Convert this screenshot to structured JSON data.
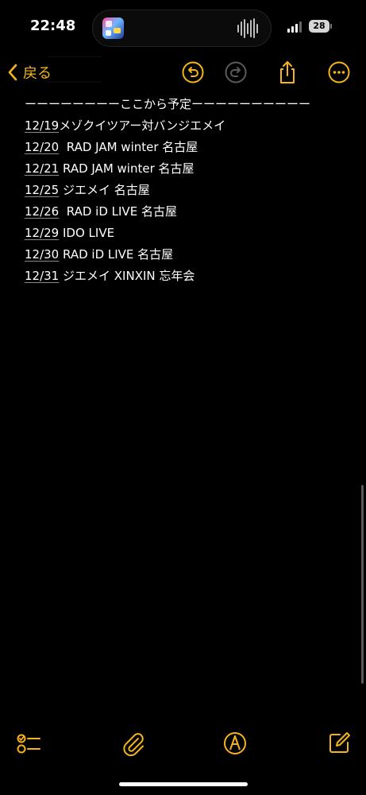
{
  "status_bar": {
    "time": "22:48",
    "battery_level": "28",
    "signal_icon": "cellular-signal-icon",
    "island_app_icon": "app-icon",
    "island_activity_icon": "audio-waveform-icon"
  },
  "nav": {
    "back_label": "戻る",
    "back_icon": "chevron-left-icon",
    "undo_icon": "undo-icon",
    "redo_icon": "redo-icon",
    "share_icon": "share-icon",
    "more_icon": "ellipsis-circle-icon",
    "accent_color": "#F5B41B"
  },
  "note": {
    "divider": "ーーーーーーーーここから予定ーーーーーーーーーー",
    "entries": [
      {
        "date": "12/19",
        "text": " メゾクイツアー対バンジエメイ"
      },
      {
        "date": "12/20",
        "text": "  RAD JAM winter 名古屋"
      },
      {
        "date": "12/21",
        "text": " RAD JAM winter 名古屋"
      },
      {
        "date": "12/25",
        "text": " ジエメイ 名古屋"
      },
      {
        "date": "12/26",
        "text": "  RAD iD LIVE 名古屋"
      },
      {
        "date": "12/29",
        "text": " IDO LIVE"
      },
      {
        "date": "12/30",
        "text": " RAD iD LIVE 名古屋"
      },
      {
        "date": "12/31",
        "text": " ジエメイ XINXIN 忘年会"
      }
    ]
  },
  "toolbar": {
    "checklist_icon": "checklist-icon",
    "attach_icon": "paperclip-icon",
    "markup_icon": "markup-pen-icon",
    "compose_icon": "compose-icon"
  }
}
